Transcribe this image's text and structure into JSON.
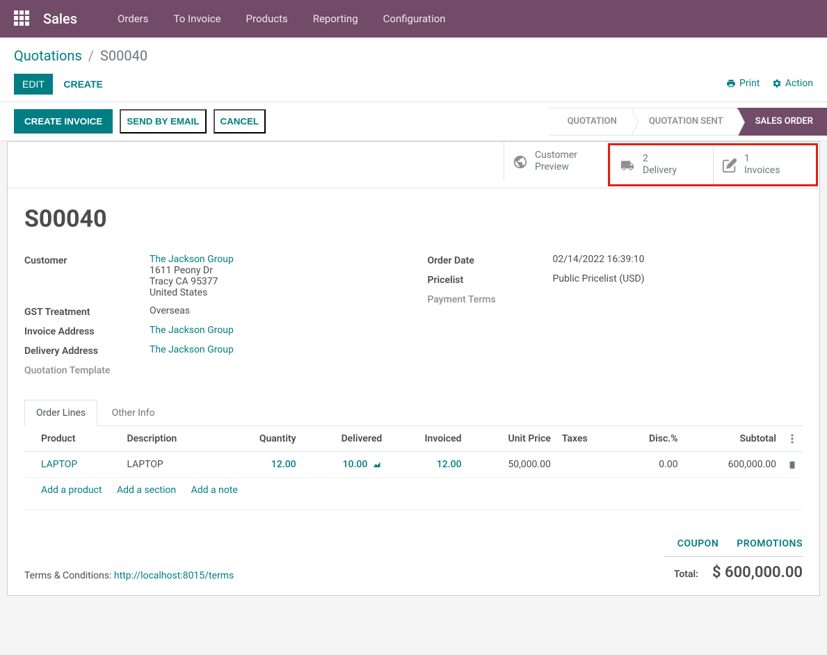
{
  "topbar": {
    "app_title": "Sales",
    "menu": [
      "Orders",
      "To Invoice",
      "Products",
      "Reporting",
      "Configuration"
    ]
  },
  "breadcrumb": {
    "root": "Quotations",
    "current": "S00040"
  },
  "buttons": {
    "edit": "EDIT",
    "create": "CREATE",
    "print": "Print",
    "action": "Action",
    "create_invoice": "CREATE INVOICE",
    "send_email": "SEND BY EMAIL",
    "cancel": "CANCEL"
  },
  "status_steps": [
    "QUOTATION",
    "QUOTATION SENT",
    "SALES ORDER"
  ],
  "stat_buttons": {
    "customer_preview": {
      "line1": "Customer",
      "line2": "Preview"
    },
    "delivery": {
      "count": "2",
      "label": "Delivery"
    },
    "invoices": {
      "count": "1",
      "label": "Invoices"
    }
  },
  "order": {
    "name": "S00040",
    "fields": {
      "customer_label": "Customer",
      "customer_name": "The Jackson Group",
      "customer_street": "1611 Peony Dr",
      "customer_city": "Tracy CA 95377",
      "customer_country": "United States",
      "gst_label": "GST Treatment",
      "gst_value": "Overseas",
      "invoice_addr_label": "Invoice Address",
      "invoice_addr": "The Jackson Group",
      "delivery_addr_label": "Delivery Address",
      "delivery_addr": "The Jackson Group",
      "quote_tpl_label": "Quotation Template",
      "order_date_label": "Order Date",
      "order_date": "02/14/2022 16:39:10",
      "pricelist_label": "Pricelist",
      "pricelist": "Public Pricelist (USD)",
      "payment_terms_label": "Payment Terms"
    }
  },
  "tabs": {
    "order_lines": "Order Lines",
    "other_info": "Other Info"
  },
  "columns": {
    "product": "Product",
    "description": "Description",
    "quantity": "Quantity",
    "delivered": "Delivered",
    "invoiced": "Invoiced",
    "unit_price": "Unit Price",
    "taxes": "Taxes",
    "disc": "Disc.%",
    "subtotal": "Subtotal"
  },
  "lines": [
    {
      "product": "LAPTOP",
      "description": "LAPTOP",
      "quantity": "12.00",
      "delivered": "10.00",
      "invoiced": "12.00",
      "unit_price": "50,000.00",
      "disc": "0.00",
      "subtotal": "600,000.00"
    }
  ],
  "line_actions": {
    "add_product": "Add a product",
    "add_section": "Add a section",
    "add_note": "Add a note"
  },
  "summary": {
    "terms_label": "Terms & Conditions: ",
    "terms_url": "http://localhost:8015/terms",
    "coupon": "COUPON",
    "promotions": "PROMOTIONS",
    "total_label": "Total:",
    "total_amount": "$ 600,000.00"
  }
}
